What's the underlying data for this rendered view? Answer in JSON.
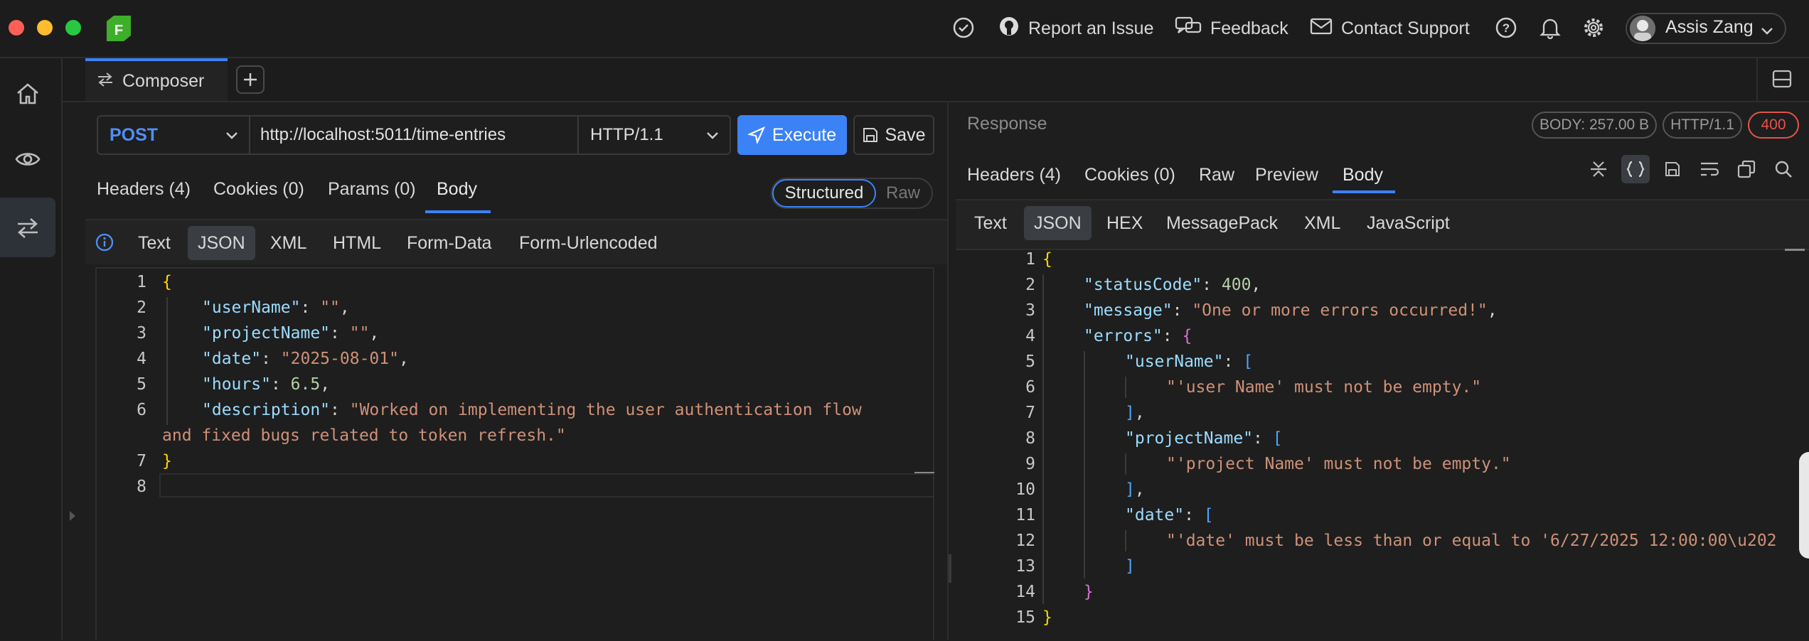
{
  "topbar": {
    "report": "Report an Issue",
    "feedback": "Feedback",
    "contact": "Contact Support",
    "user": "Assis Zang",
    "logo_letter": "F"
  },
  "composer_tab": {
    "label": "Composer"
  },
  "request": {
    "method": "POST",
    "url": "http://localhost:5011/time-entries",
    "http_version": "HTTP/1.1",
    "execute_label": "Execute",
    "save_label": "Save",
    "tabs": [
      "Headers (4)",
      "Cookies (0)",
      "Params (0)",
      "Body"
    ],
    "active_tab": "Body",
    "structured_label": "Structured",
    "raw_label": "Raw",
    "body_types": [
      "Text",
      "JSON",
      "XML",
      "HTML",
      "Form-Data",
      "Form-Urlencoded"
    ],
    "active_body_type": "JSON",
    "line_numbers": [
      "1",
      "2",
      "3",
      "4",
      "5",
      "6",
      "",
      "7",
      "8"
    ],
    "code": {
      "open": "{",
      "k1": "\"userName\"",
      "v1": "\"\"",
      "k2": "\"projectName\"",
      "v2": "\"\"",
      "k3": "\"date\"",
      "v3": "\"2025-08-01\"",
      "k4": "\"hours\"",
      "v4": "6.5",
      "k5": "\"description\"",
      "v5a": "\"Worked on implementing the user authentication flow",
      "v5b": "and fixed bugs related to token refresh.\"",
      "close": "}"
    }
  },
  "response": {
    "label": "Response",
    "size_badge": "BODY: 257.00 B",
    "http_badge": "HTTP/1.1",
    "status_badge": "400",
    "tabs": [
      "Headers (4)",
      "Cookies (0)",
      "Raw",
      "Preview",
      "Body"
    ],
    "active_tab": "Body",
    "body_types": [
      "Text",
      "JSON",
      "HEX",
      "MessagePack",
      "XML",
      "JavaScript"
    ],
    "active_body_type": "JSON",
    "line_numbers": [
      "1",
      "2",
      "3",
      "4",
      "5",
      "6",
      "7",
      "8",
      "9",
      "10",
      "11",
      "12",
      "13",
      "14",
      "15"
    ],
    "code": {
      "open": "{",
      "statusCode_key": "\"statusCode\"",
      "statusCode_val": "400",
      "message_key": "\"message\"",
      "message_val": "\"One or more errors occurred!\"",
      "errors_key": "\"errors\"",
      "userName_key": "\"userName\"",
      "userName_err": "\"'user Name' must not be empty.\"",
      "projectName_key": "\"projectName\"",
      "projectName_err": "\"'project Name' must not be empty.\"",
      "date_key": "\"date\"",
      "date_err": "\"'date' must be less than or equal to '6/27/2025 12:00:00\\u202",
      "close": "}"
    }
  },
  "colors": {
    "accent": "#3b82f6",
    "error": "#e5534b",
    "logo": "#4caf50"
  }
}
